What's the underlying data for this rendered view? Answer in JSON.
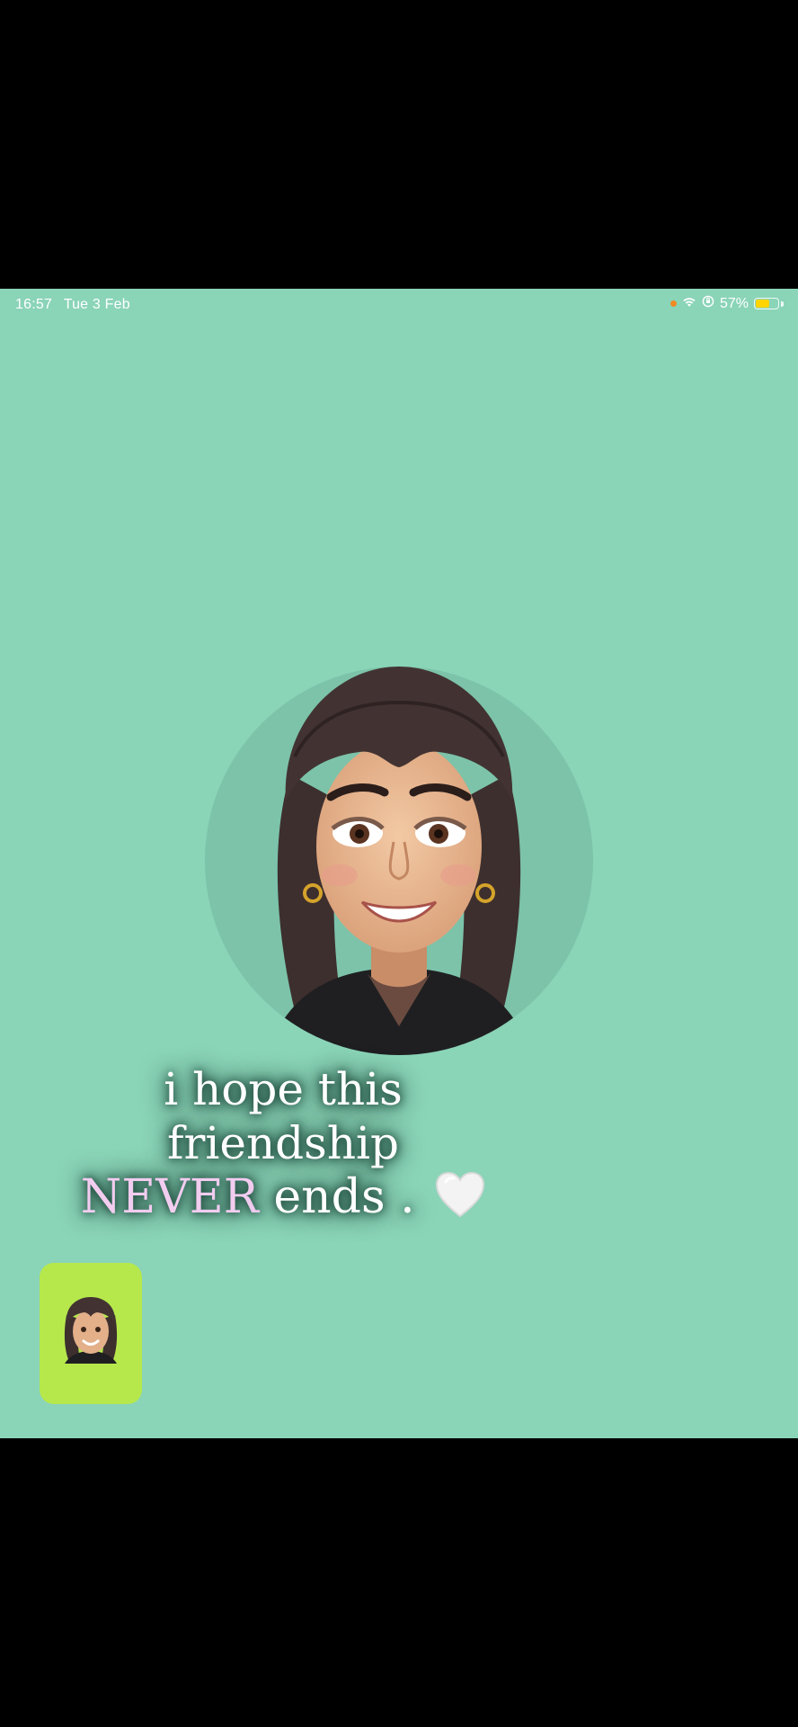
{
  "status_bar": {
    "time": "16:57",
    "date": "Tue 3 Feb",
    "battery_percent": "57%",
    "battery_level": 0.57,
    "icons": [
      "orange-dot-icon",
      "wifi-icon",
      "orientation-lock-icon",
      "battery-icon"
    ]
  },
  "caption": {
    "line1": "i hope this friendship",
    "line2_highlight": "NEVER",
    "line2_rest": "ends ."
  },
  "colors": {
    "background": "#8ad4b8",
    "letterbox": "#000000",
    "avatar_circle": "#7cc3aa",
    "pip_background": "#b6e84c",
    "highlight_text": "#f2cdf0"
  }
}
